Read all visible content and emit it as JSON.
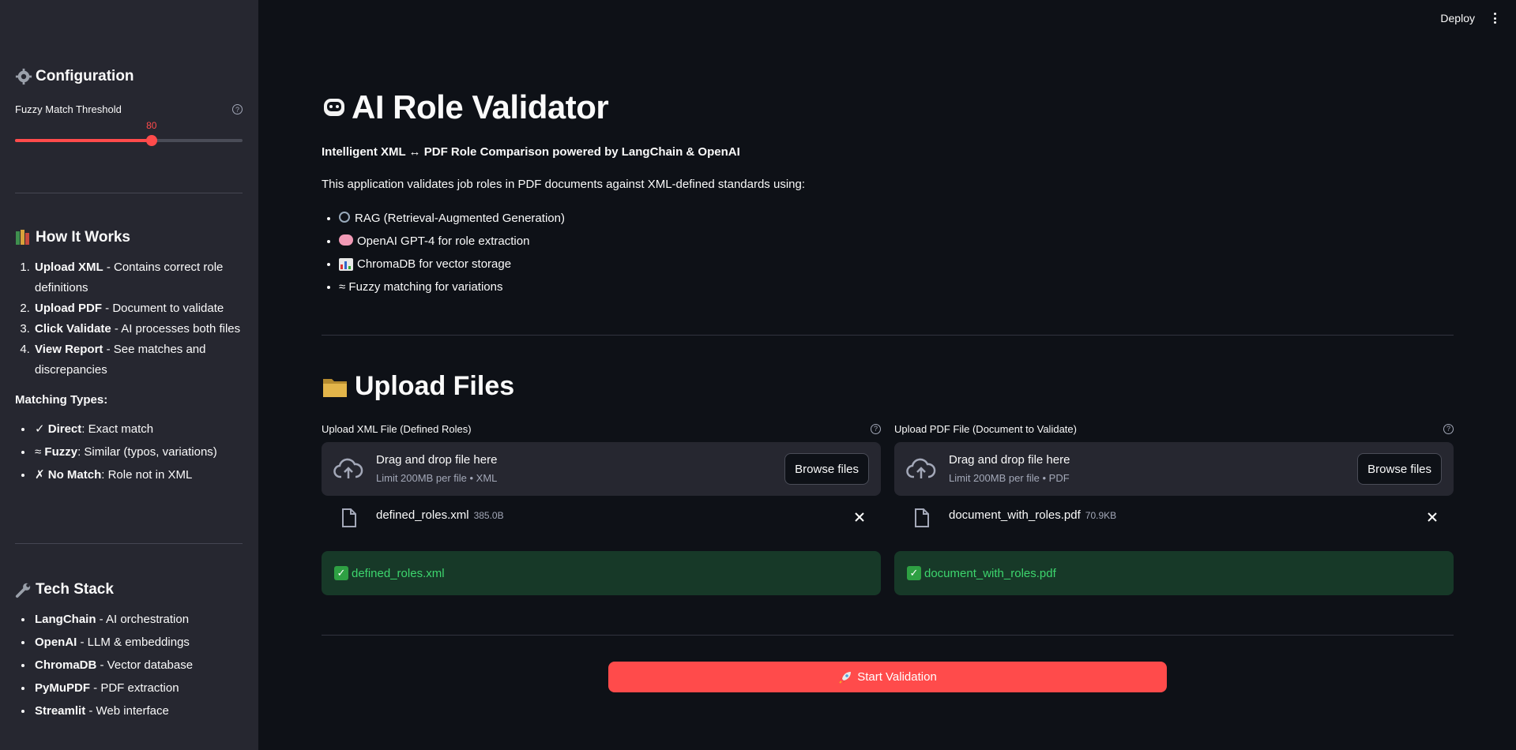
{
  "topbar": {
    "deploy_label": "Deploy",
    "menu_icon": "kebab-menu-icon"
  },
  "sidebar": {
    "config": {
      "icon": "gear-icon",
      "title": "Configuration",
      "slider_label": "Fuzzy Match Threshold",
      "slider_value": "80",
      "slider_fraction": 0.6
    },
    "how": {
      "icon": "books-icon",
      "title": "How It Works",
      "steps": [
        {
          "bold": "Upload XML",
          "rest": " - Contains correct role definitions"
        },
        {
          "bold": "Upload PDF",
          "rest": " - Document to validate"
        },
        {
          "bold": "Click Validate",
          "rest": " - AI processes both files"
        },
        {
          "bold": "View Report",
          "rest": " - See matches and discrepancies"
        }
      ],
      "matching_title": "Matching Types:",
      "matching": [
        {
          "prefix": "✓ ",
          "bold": "Direct",
          "rest": ": Exact match"
        },
        {
          "prefix": "≈ ",
          "bold": "Fuzzy",
          "rest": ": Similar (typos, variations)"
        },
        {
          "prefix": "✗ ",
          "bold": "No Match",
          "rest": ": Role not in XML"
        }
      ]
    },
    "tech": {
      "icon": "wrench-icon",
      "title": "Tech Stack",
      "items": [
        {
          "bold": "LangChain",
          "rest": " - AI orchestration"
        },
        {
          "bold": "OpenAI",
          "rest": " - LLM & embeddings"
        },
        {
          "bold": "ChromaDB",
          "rest": " - Vector database"
        },
        {
          "bold": "PyMuPDF",
          "rest": " - PDF extraction"
        },
        {
          "bold": "Streamlit",
          "rest": " - Web interface"
        }
      ]
    }
  },
  "main": {
    "title_icon": "robot-icon",
    "title": "AI Role Validator",
    "subtitle": "Intelligent XML ↔ PDF Role Comparison powered by LangChain & OpenAI",
    "intro": "This application validates job roles in PDF documents against XML-defined standards using:",
    "features": [
      {
        "icon": "magnifier-icon",
        "text": "RAG (Retrieval-Augmented Generation)"
      },
      {
        "icon": "brain-icon",
        "text": "OpenAI GPT-4 for role extraction"
      },
      {
        "icon": "bar-chart-icon",
        "text": "ChromaDB for vector storage"
      },
      {
        "icon": "approx-icon",
        "text": "≈ Fuzzy matching for variations"
      }
    ],
    "upload_icon": "folder-icon",
    "upload_title": "Upload Files",
    "uploaders": [
      {
        "label": "Upload XML File (Defined Roles)",
        "drag_text": "Drag and drop file here",
        "limit": "Limit 200MB per file • XML",
        "browse": "Browse files",
        "file_name": "defined_roles.xml",
        "file_size": "385.0B",
        "success": "defined_roles.xml"
      },
      {
        "label": "Upload PDF File (Document to Validate)",
        "drag_text": "Drag and drop file here",
        "limit": "Limit 200MB per file • PDF",
        "browse": "Browse files",
        "file_name": "document_with_roles.pdf",
        "file_size": "70.9KB",
        "success": "document_with_roles.pdf"
      }
    ],
    "start_icon": "rocket-icon",
    "start_label": "Start Validation",
    "colors": {
      "accent": "#ff4b4b",
      "success_text": "#3dd56d",
      "success_bg": "#173928",
      "sidebar_bg": "#262730",
      "app_bg": "#0e1117"
    }
  }
}
